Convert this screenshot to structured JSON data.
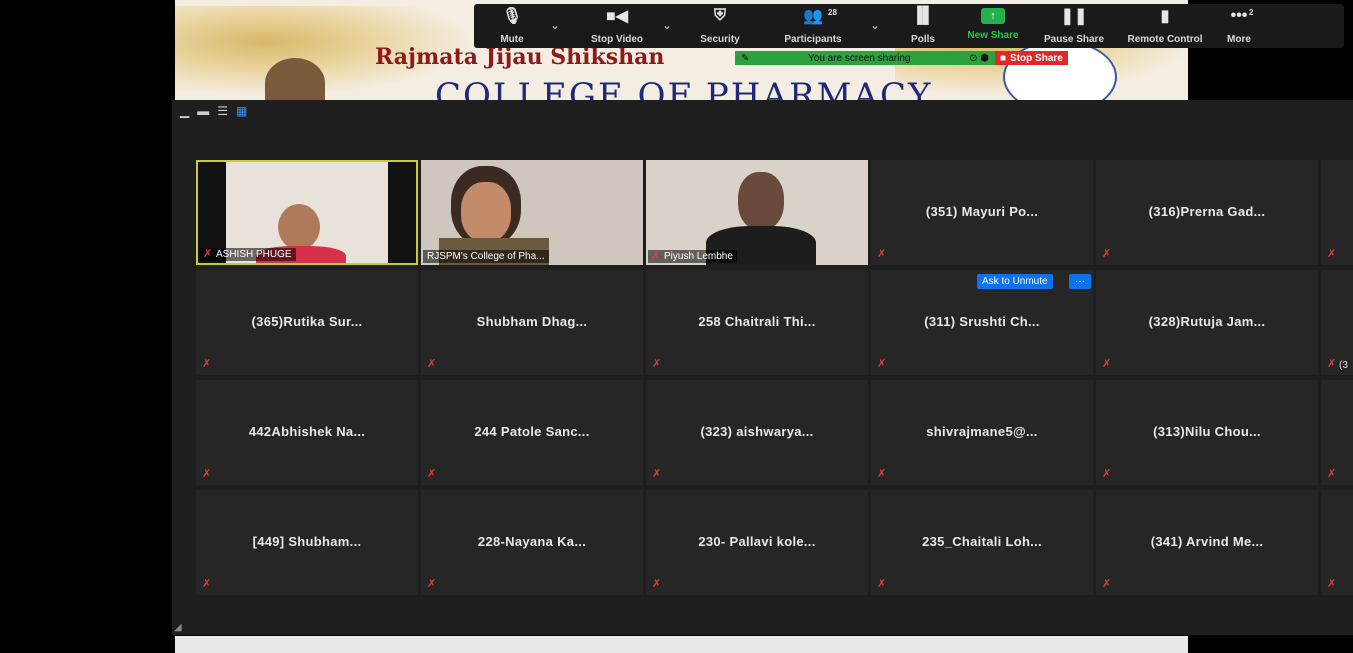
{
  "slide": {
    "title_line1": "Rajmata Jijau Shikshan",
    "title_line2": "COLLEGE OF PHARMACY"
  },
  "toolbar": {
    "mute": "Mute",
    "stop_video": "Stop Video",
    "security": "Security",
    "participants": "Participants",
    "participants_count": "28",
    "polls": "Polls",
    "new_share": "New Share",
    "pause_share": "Pause Share",
    "remote_control": "Remote Control",
    "more": "More",
    "more_badge": "2"
  },
  "banner": {
    "sharing_text": "You are screen sharing",
    "stop_share": "Stop Share"
  },
  "gallery": {
    "ask_to_unmute": "Ask to Unmute",
    "more_btn": "···",
    "video_tiles": [
      {
        "name": "ASHISH PHUGE"
      },
      {
        "name": "RJSPM's College of Pha..."
      },
      {
        "name": "Piyush Lembhe"
      }
    ],
    "name_tiles": [
      "(351) Mayuri Po...",
      "(316)Prerna Gad...",
      "(365)Rutika Sur...",
      "Shubham  Dhag...",
      "258 Chaitrali Thi...",
      "(311) Srushti Ch...",
      "(328)Rutuja Jam...",
      "442Abhishek Na...",
      "244 Patole Sanc...",
      "(323) aishwarya...",
      "shivrajmane5@...",
      "(313)Nilu Chou...",
      "[449] Shubham...",
      "228-Nayana Ka...",
      "230- Pallavi kole...",
      "235_Chaitali Loh...",
      "(341) Arvind Me..."
    ],
    "edge_label": "(3"
  }
}
